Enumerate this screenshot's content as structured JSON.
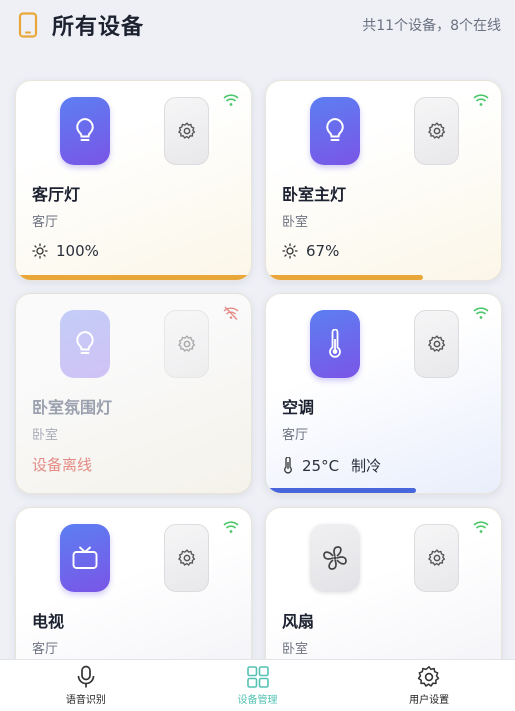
{
  "header": {
    "title": "所有设备",
    "summary": "共11个设备，8个在线",
    "icon": "phone-icon"
  },
  "colors": {
    "accent_gradient": [
      "#5c7ff2",
      "#7a55e6"
    ],
    "bar_orange": "#e9a739",
    "bar_blue": "#4766db",
    "online_green": "#4cc76a",
    "offline_red": "#e48b86",
    "tab_active": "#55c2b4"
  },
  "devices": [
    {
      "name": "客厅灯",
      "room": "客厅",
      "status": "100%",
      "icon": "lightbulb-icon",
      "online": true,
      "progress": 100
    },
    {
      "name": "卧室主灯",
      "room": "卧室",
      "status": "67%",
      "icon": "lightbulb-icon",
      "online": true,
      "progress": 67
    },
    {
      "name": "卧室氛围灯",
      "room": "卧室",
      "status": "设备离线",
      "icon": "lightbulb-icon",
      "online": false
    },
    {
      "name": "空调",
      "room": "客厅",
      "status": "25°C",
      "mode": "制冷",
      "icon": "thermometer-icon",
      "online": true,
      "progress": 64
    },
    {
      "name": "电视",
      "room": "客厅",
      "icon": "tv-icon",
      "online": true
    },
    {
      "name": "风扇",
      "room": "卧室",
      "icon": "fan-icon",
      "online": true
    }
  ],
  "tabs": [
    {
      "label": "语音识别",
      "icon": "microphone-icon",
      "active": false
    },
    {
      "label": "设备管理",
      "icon": "grid-icon",
      "active": true
    },
    {
      "label": "用户设置",
      "icon": "gear-icon",
      "active": false
    }
  ]
}
